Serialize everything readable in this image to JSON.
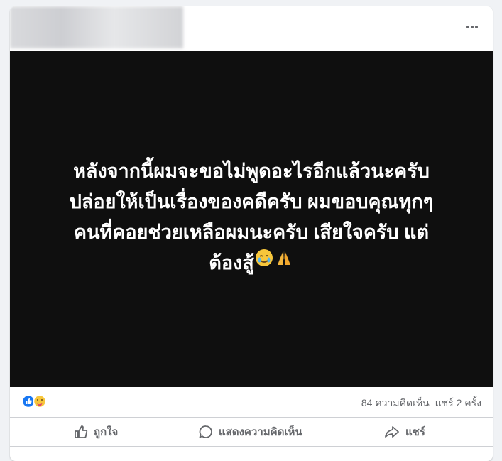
{
  "post": {
    "text_lines": [
      "หลังจากนี้ผมจะขอไม่พูดอะไรอีกแล้วนะครับ",
      "ปล่อยให้เป็นเรื่องของคดีครับ ผมขอบคุณทุกๆ",
      "คนที่คอยช่วยเหลือผมนะครับ เสียใจครับ แต่",
      "ต้องสู้"
    ],
    "icons": {
      "more": "more-horizontal-icon",
      "emoji_1": "crying-smile-emoji",
      "emoji_2": "folded-hands-emoji"
    }
  },
  "stats": {
    "comments": "84 ความคิดเห็น",
    "shares": "แชร์ 2 ครั้ง",
    "reaction_icons": [
      "like-icon",
      "care-icon"
    ]
  },
  "actions": {
    "like": "ถูกใจ",
    "comment": "แสดงความคิดเห็น",
    "share": "แชร์"
  },
  "colors": {
    "page_bg": "#f0f2f5",
    "image_bg": "#0f0f0f",
    "like_blue": "#1877f2",
    "muted_text": "#65676b"
  }
}
